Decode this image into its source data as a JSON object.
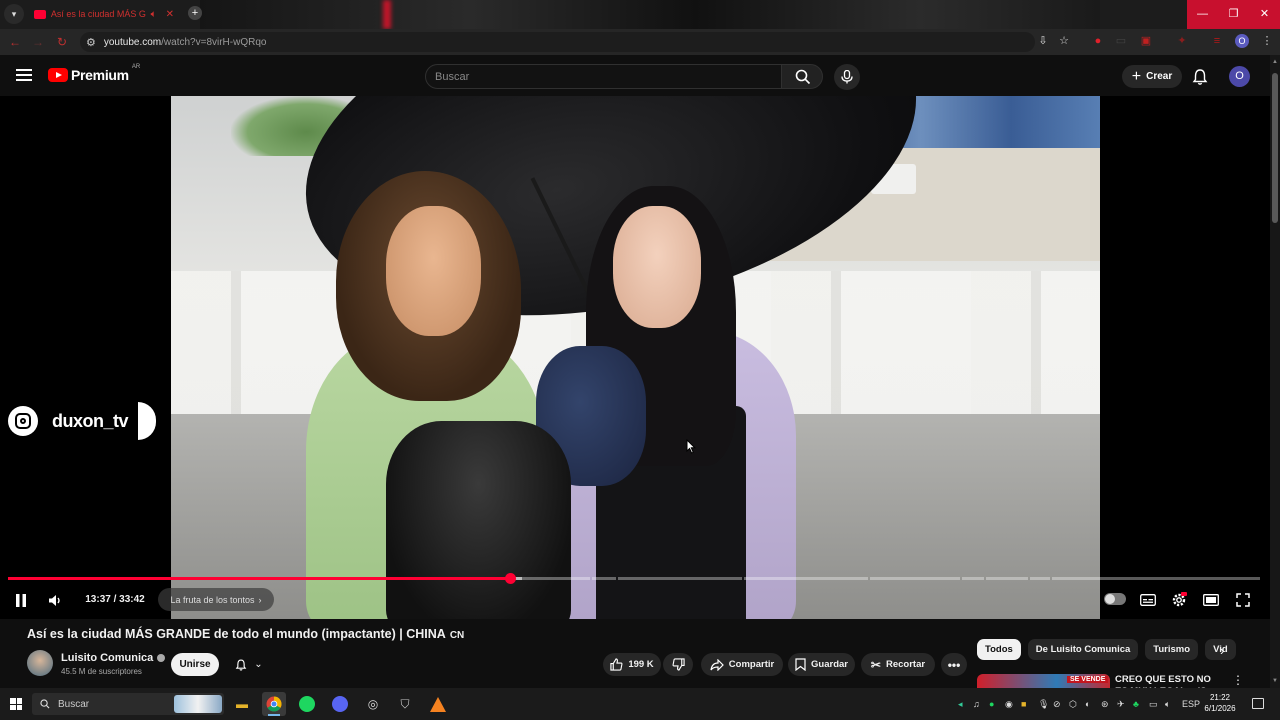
{
  "browser": {
    "tab_title": "Así es la ciudad MÁS GRAN",
    "url_host": "youtube.com",
    "url_path": "/watch?v=8virH-wQRqo",
    "profile_initial": "O"
  },
  "masthead": {
    "logo_text": "Premium",
    "country_code": "AR",
    "search_placeholder": "Buscar",
    "create_label": "Crear",
    "avatar_initial": "O"
  },
  "player": {
    "overlay_handle": "duxon_tv",
    "current_time": "13:37",
    "duration": "33:42",
    "time_display": "13:37 / 33:42",
    "chapter_title": "La fruta de los tontos",
    "progress_played_fraction": 0.4,
    "progress_loaded_fraction": 0.41
  },
  "video": {
    "title": "Así es la ciudad MÁS GRANDE de todo el mundo (impactante) | CHINA",
    "title_flag": "CN",
    "channel_name": "Luisito Comunica",
    "subscribers": "45.5 M de suscriptores",
    "join_label": "Unirse",
    "likes": "199 K",
    "share_label": "Compartir",
    "save_label": "Guardar",
    "clip_label": "Recortar"
  },
  "sidebar": {
    "chips": [
      "Todos",
      "De Luisito Comunica",
      "Turismo",
      "Vid"
    ],
    "active_chip": "Todos",
    "recommendation": {
      "title": "CREO QUE ESTO NO ES MUY LEGAL... (Car Deals",
      "thumb_badge": "SE VENDE"
    }
  },
  "taskbar": {
    "search_placeholder": "Buscar",
    "language": "ESP",
    "time": "21:22",
    "date": "6/1/2026"
  },
  "colors": {
    "accent_red": "#ff0033",
    "background": "#0f0f0f",
    "chip_bg": "#272727"
  }
}
